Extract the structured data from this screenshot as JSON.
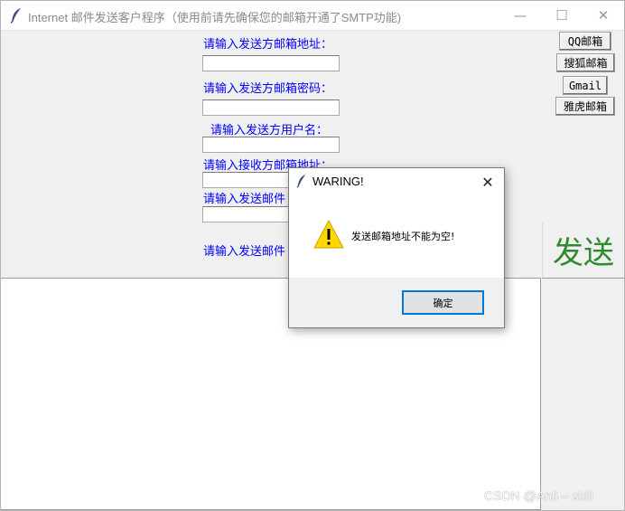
{
  "window": {
    "title": "Internet 邮件发送客户程序（使用前请先确保您的邮箱开通了SMTP功能)",
    "minimize_glyph": "—",
    "maximize_glyph": "☐",
    "close_glyph": "✕"
  },
  "form": {
    "sender_email_label": "请输入发送方邮箱地址：",
    "sender_password_label": "请输入发送方邮箱密码：",
    "sender_username_label": "请输入发送方用户名：",
    "receiver_email_label": "请输入接收方邮箱地址：",
    "subject_label": "请输入发送邮件",
    "body_label": "请输入发送邮件",
    "sender_email_value": "",
    "sender_password_value": "",
    "sender_username_value": "",
    "receiver_email_value": "",
    "subject_value": ""
  },
  "providers": {
    "qq": "QQ邮箱",
    "sohu": "搜狐邮箱",
    "gmail": "Gmail",
    "yahoo": "雅虎邮箱"
  },
  "send_button": "发送",
  "output_text": "",
  "dialog": {
    "title": "WARING!",
    "message": "发送邮箱地址不能为空!",
    "ok_label": "确定",
    "close_glyph": "✕",
    "icon": "warning-icon"
  },
  "watermark": "CSDN @Anti – skill",
  "colors": {
    "label": "#0000ff",
    "send_text": "#2e8b2e",
    "warning": "#ffd800",
    "focus_border": "#0078d7"
  }
}
